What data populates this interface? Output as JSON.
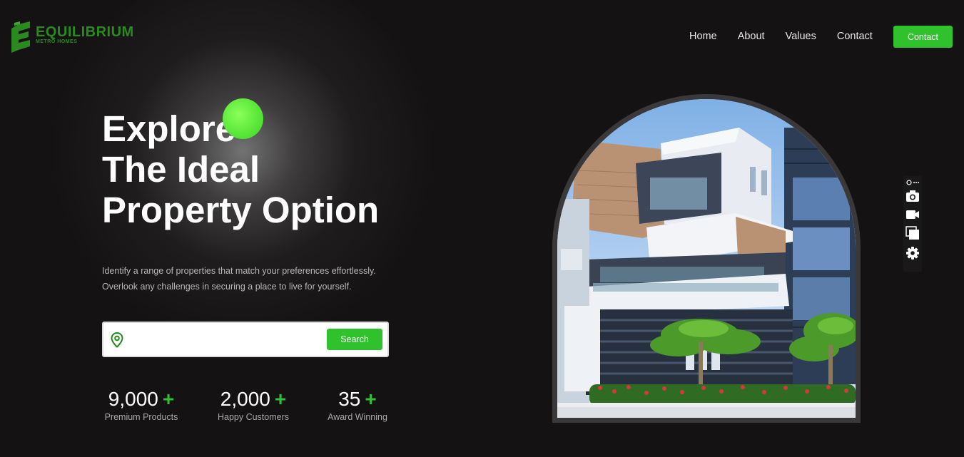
{
  "brand": {
    "name": "EQUILIBRIUM",
    "tagline": "METRO HOMES",
    "accent": "#2fc22c",
    "logo_color": "#2a8a1f"
  },
  "nav": {
    "items": [
      {
        "label": "Home"
      },
      {
        "label": "About"
      },
      {
        "label": "Values"
      },
      {
        "label": "Contact"
      }
    ],
    "cta_label": "Contact"
  },
  "hero": {
    "title_lines": [
      "Explore",
      "The Ideal",
      "Property Option"
    ],
    "description_lines": [
      "Identify a range of properties that match your preferences effortlessly.",
      "Overlook any challenges in securing a place to live for yourself."
    ]
  },
  "search": {
    "placeholder": "",
    "value": "",
    "button_label": "Search",
    "icon": "location-pin-icon"
  },
  "stats": [
    {
      "value": "9,000",
      "suffix": "+",
      "label": "Premium Products"
    },
    {
      "value": "2,000",
      "suffix": "+",
      "label": "Happy Customers"
    },
    {
      "value": "35",
      "suffix": "+",
      "label": "Award Winning"
    }
  ],
  "toolbar": {
    "icons": [
      "settings-dots-icon",
      "camera-icon",
      "video-icon",
      "gallery-icon",
      "gear-icon"
    ]
  },
  "colors": {
    "background": "#141212",
    "text": "#ffffff",
    "muted": "#a8a8a8"
  }
}
